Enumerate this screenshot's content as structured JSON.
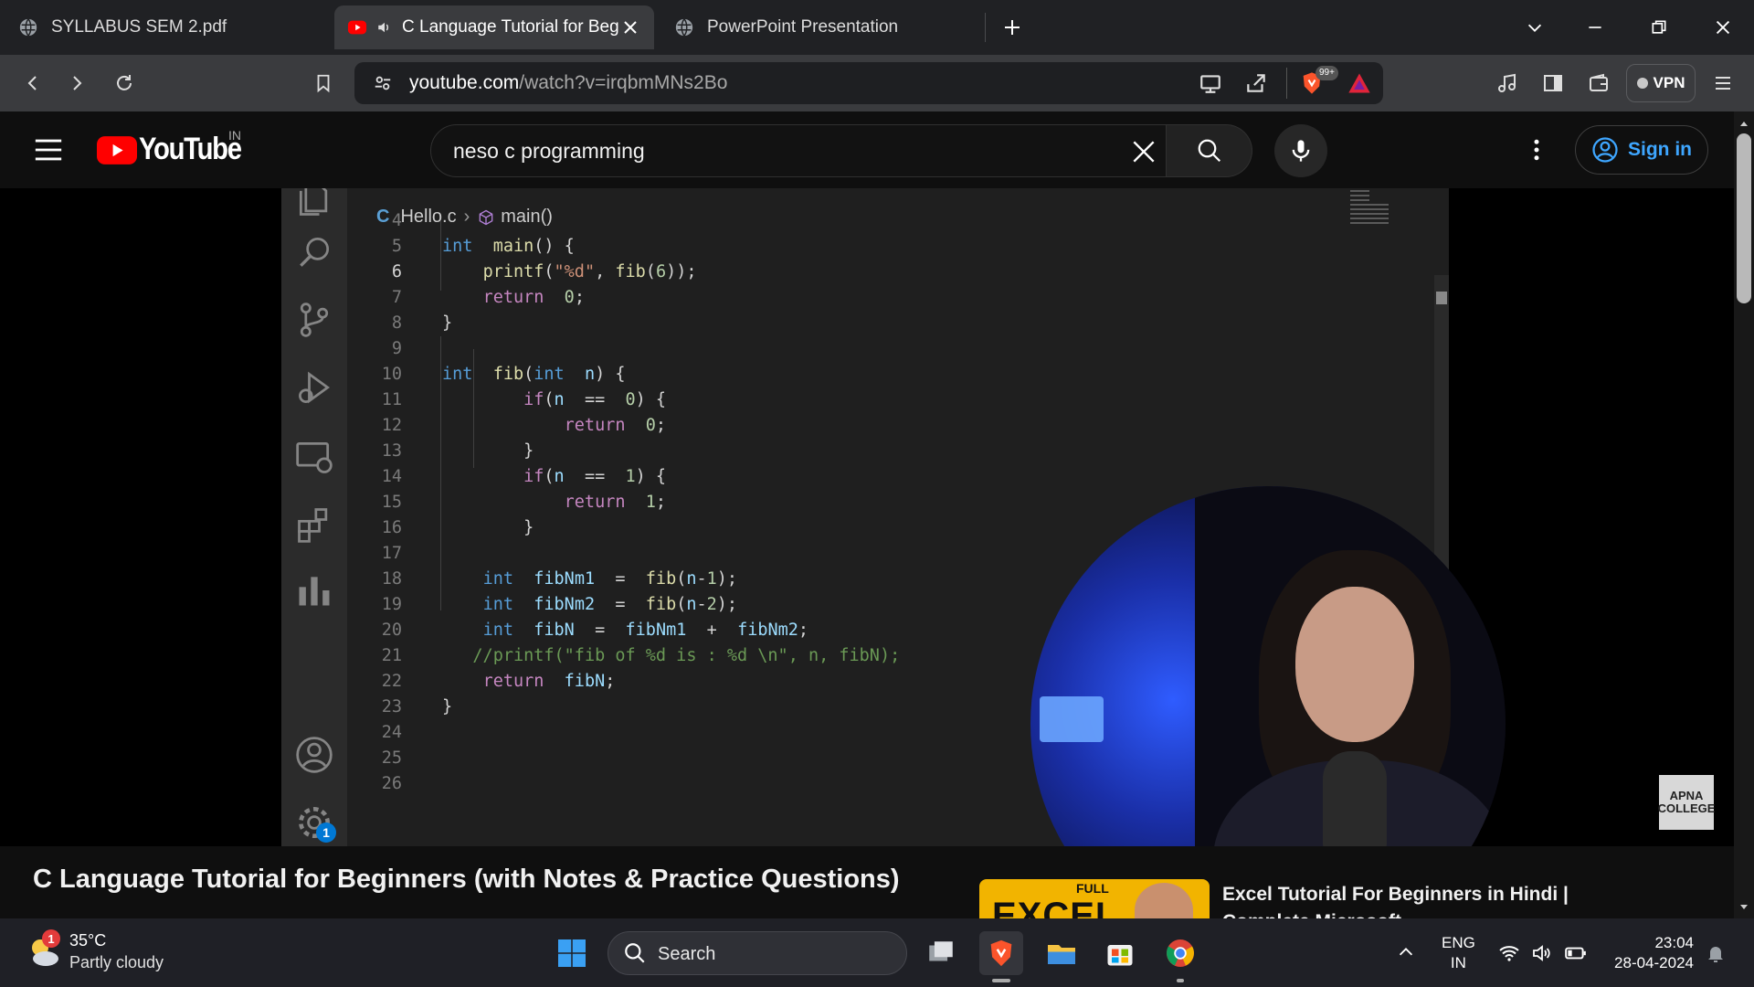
{
  "browser": {
    "tabs": [
      {
        "title": "SYLLABUS SEM 2.pdf",
        "active": false
      },
      {
        "title": "C Language Tutorial for Begi",
        "active": true
      },
      {
        "title": "PowerPoint Presentation",
        "active": false
      }
    ],
    "address": {
      "host": "youtube.com",
      "path": "/watch?v=irqbmMNs2Bo"
    },
    "shields_badge": "99+",
    "vpn_label": "VPN"
  },
  "youtube": {
    "wordmark": "YouTube",
    "country": "IN",
    "search_value": "neso c programming",
    "sign_in_label": "Sign in",
    "video_title": "C Language Tutorial for Beginners (with Notes & Practice Questions)",
    "recommended": {
      "thumb_text": "EXCEL",
      "thumb_tag": "FULL",
      "title": "Excel Tutorial For Beginners in Hindi | Complete Microsoft"
    },
    "watermark": {
      "line1": "APNA",
      "line2": "COLLEGE"
    }
  },
  "editor": {
    "breadcrumb": {
      "lang": "C",
      "file": "Hello.c",
      "symbol": "main()"
    },
    "settings_badge": "1",
    "current_line": 6,
    "lines": [
      {
        "n": 4,
        "tokens": []
      },
      {
        "n": 5,
        "tokens": [
          [
            "kw",
            "int"
          ],
          [
            "",
            "  "
          ],
          [
            "fn",
            "main"
          ],
          [
            "",
            "() {"
          ]
        ]
      },
      {
        "n": 6,
        "tokens": [
          [
            "",
            "    "
          ],
          [
            "fn",
            "printf"
          ],
          [
            "",
            "("
          ],
          [
            "str",
            "\"%d\""
          ],
          [
            "",
            ", "
          ],
          [
            "fn",
            "fib"
          ],
          [
            "",
            "("
          ],
          [
            "num",
            "6"
          ],
          [
            "",
            "));"
          ]
        ]
      },
      {
        "n": 7,
        "tokens": [
          [
            "",
            "    "
          ],
          [
            "ctl",
            "return"
          ],
          [
            "",
            "  "
          ],
          [
            "num",
            "0"
          ],
          [
            "",
            ";"
          ]
        ]
      },
      {
        "n": 8,
        "tokens": [
          [
            "",
            "}"
          ]
        ]
      },
      {
        "n": 9,
        "tokens": []
      },
      {
        "n": 10,
        "tokens": [
          [
            "kw",
            "int"
          ],
          [
            "",
            "  "
          ],
          [
            "fn",
            "fib"
          ],
          [
            "",
            "("
          ],
          [
            "kw",
            "int"
          ],
          [
            "",
            "  "
          ],
          [
            "var",
            "n"
          ],
          [
            "",
            ") {"
          ]
        ]
      },
      {
        "n": 11,
        "tokens": [
          [
            "",
            "        "
          ],
          [
            "ctl",
            "if"
          ],
          [
            "",
            "("
          ],
          [
            "var",
            "n"
          ],
          [
            "",
            "  ==  "
          ],
          [
            "num",
            "0"
          ],
          [
            "",
            ") {"
          ]
        ]
      },
      {
        "n": 12,
        "tokens": [
          [
            "",
            "            "
          ],
          [
            "ctl",
            "return"
          ],
          [
            "",
            "  "
          ],
          [
            "num",
            "0"
          ],
          [
            "",
            ";"
          ]
        ]
      },
      {
        "n": 13,
        "tokens": [
          [
            "",
            "        }"
          ]
        ]
      },
      {
        "n": 14,
        "tokens": [
          [
            "",
            "        "
          ],
          [
            "ctl",
            "if"
          ],
          [
            "",
            "("
          ],
          [
            "var",
            "n"
          ],
          [
            "",
            "  ==  "
          ],
          [
            "num",
            "1"
          ],
          [
            "",
            ") {"
          ]
        ]
      },
      {
        "n": 15,
        "tokens": [
          [
            "",
            "            "
          ],
          [
            "ctl",
            "return"
          ],
          [
            "",
            "  "
          ],
          [
            "num",
            "1"
          ],
          [
            "",
            ";"
          ]
        ]
      },
      {
        "n": 16,
        "tokens": [
          [
            "",
            "        }"
          ]
        ]
      },
      {
        "n": 17,
        "tokens": []
      },
      {
        "n": 18,
        "tokens": [
          [
            "",
            "    "
          ],
          [
            "kw",
            "int"
          ],
          [
            "",
            "  "
          ],
          [
            "var",
            "fibNm1"
          ],
          [
            "",
            "  =  "
          ],
          [
            "fn",
            "fib"
          ],
          [
            "",
            "("
          ],
          [
            "var",
            "n"
          ],
          [
            "",
            "-"
          ],
          [
            "num",
            "1"
          ],
          [
            "",
            ");"
          ]
        ]
      },
      {
        "n": 19,
        "tokens": [
          [
            "",
            "    "
          ],
          [
            "kw",
            "int"
          ],
          [
            "",
            "  "
          ],
          [
            "var",
            "fibNm2"
          ],
          [
            "",
            "  =  "
          ],
          [
            "fn",
            "fib"
          ],
          [
            "",
            "("
          ],
          [
            "var",
            "n"
          ],
          [
            "",
            "-"
          ],
          [
            "num",
            "2"
          ],
          [
            "",
            ");"
          ]
        ]
      },
      {
        "n": 20,
        "tokens": [
          [
            "",
            "    "
          ],
          [
            "kw",
            "int"
          ],
          [
            "",
            "  "
          ],
          [
            "var",
            "fibN"
          ],
          [
            "",
            "  =  "
          ],
          [
            "var",
            "fibNm1"
          ],
          [
            "",
            "  +  "
          ],
          [
            "var",
            "fibNm2"
          ],
          [
            "",
            ";"
          ]
        ]
      },
      {
        "n": 21,
        "tokens": [
          [
            "",
            "   "
          ],
          [
            "cm",
            "//printf(\"fib of %d is : %d \\n\", n, fibN);"
          ]
        ]
      },
      {
        "n": 22,
        "tokens": [
          [
            "",
            "    "
          ],
          [
            "ctl",
            "return"
          ],
          [
            "",
            "  "
          ],
          [
            "var",
            "fibN"
          ],
          [
            "",
            ";"
          ]
        ]
      },
      {
        "n": 23,
        "tokens": [
          [
            "",
            "}"
          ]
        ]
      },
      {
        "n": 24,
        "tokens": []
      },
      {
        "n": 25,
        "tokens": []
      },
      {
        "n": 26,
        "tokens": []
      }
    ]
  },
  "taskbar": {
    "weather_temp": "35°C",
    "weather_desc": "Partly cloudy",
    "weather_badge": "1",
    "search_label": "Search",
    "lang_line1": "ENG",
    "lang_line2": "IN",
    "time": "23:04",
    "date": "28-04-2024"
  },
  "colors": {
    "yt_red": "#ff0000",
    "accent_blue": "#3ea6ff",
    "brave_orange": "#fb542b",
    "vscode_bg": "#1f1f1f"
  }
}
